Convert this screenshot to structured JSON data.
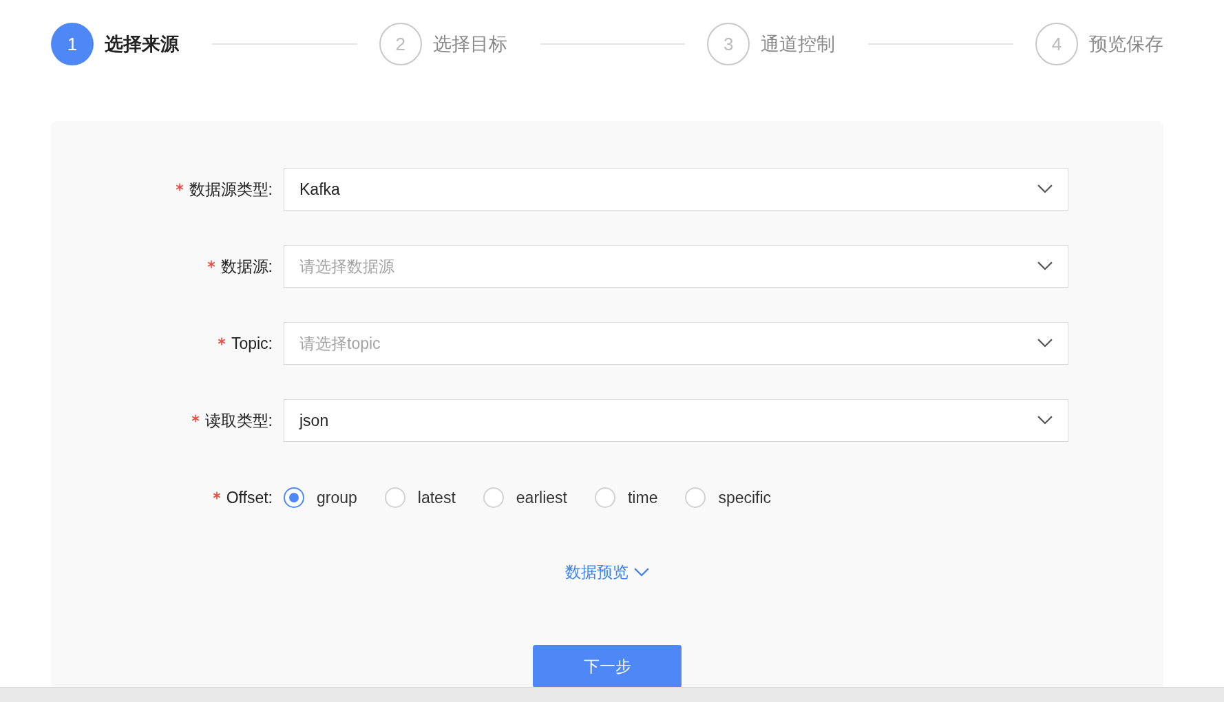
{
  "steps": [
    {
      "number": "1",
      "label": "选择来源",
      "selected": true
    },
    {
      "number": "2",
      "label": "选择目标",
      "selected": false
    },
    {
      "number": "3",
      "label": "通道控制",
      "selected": false
    },
    {
      "number": "4",
      "label": "预览保存",
      "selected": false
    }
  ],
  "form": {
    "fields": [
      {
        "kind": "select",
        "label": "数据源类型:",
        "required": true,
        "value": "Kafka"
      },
      {
        "kind": "select",
        "label": "数据源:",
        "required": true,
        "placeholder": "请选择数据源"
      },
      {
        "kind": "select",
        "label": "Topic:",
        "required": true,
        "placeholder": "请选择topic"
      },
      {
        "kind": "select",
        "label": "读取类型:",
        "required": true,
        "value": "json"
      },
      {
        "kind": "radio",
        "label": "Offset:",
        "required": true,
        "options": [
          {
            "label": "group",
            "selected": true
          },
          {
            "label": "latest",
            "selected": false
          },
          {
            "label": "earliest",
            "selected": false
          },
          {
            "label": "time",
            "selected": false
          },
          {
            "label": "specific",
            "selected": false
          }
        ]
      }
    ],
    "preview_link": "数据预览",
    "next_button": "下一步"
  }
}
